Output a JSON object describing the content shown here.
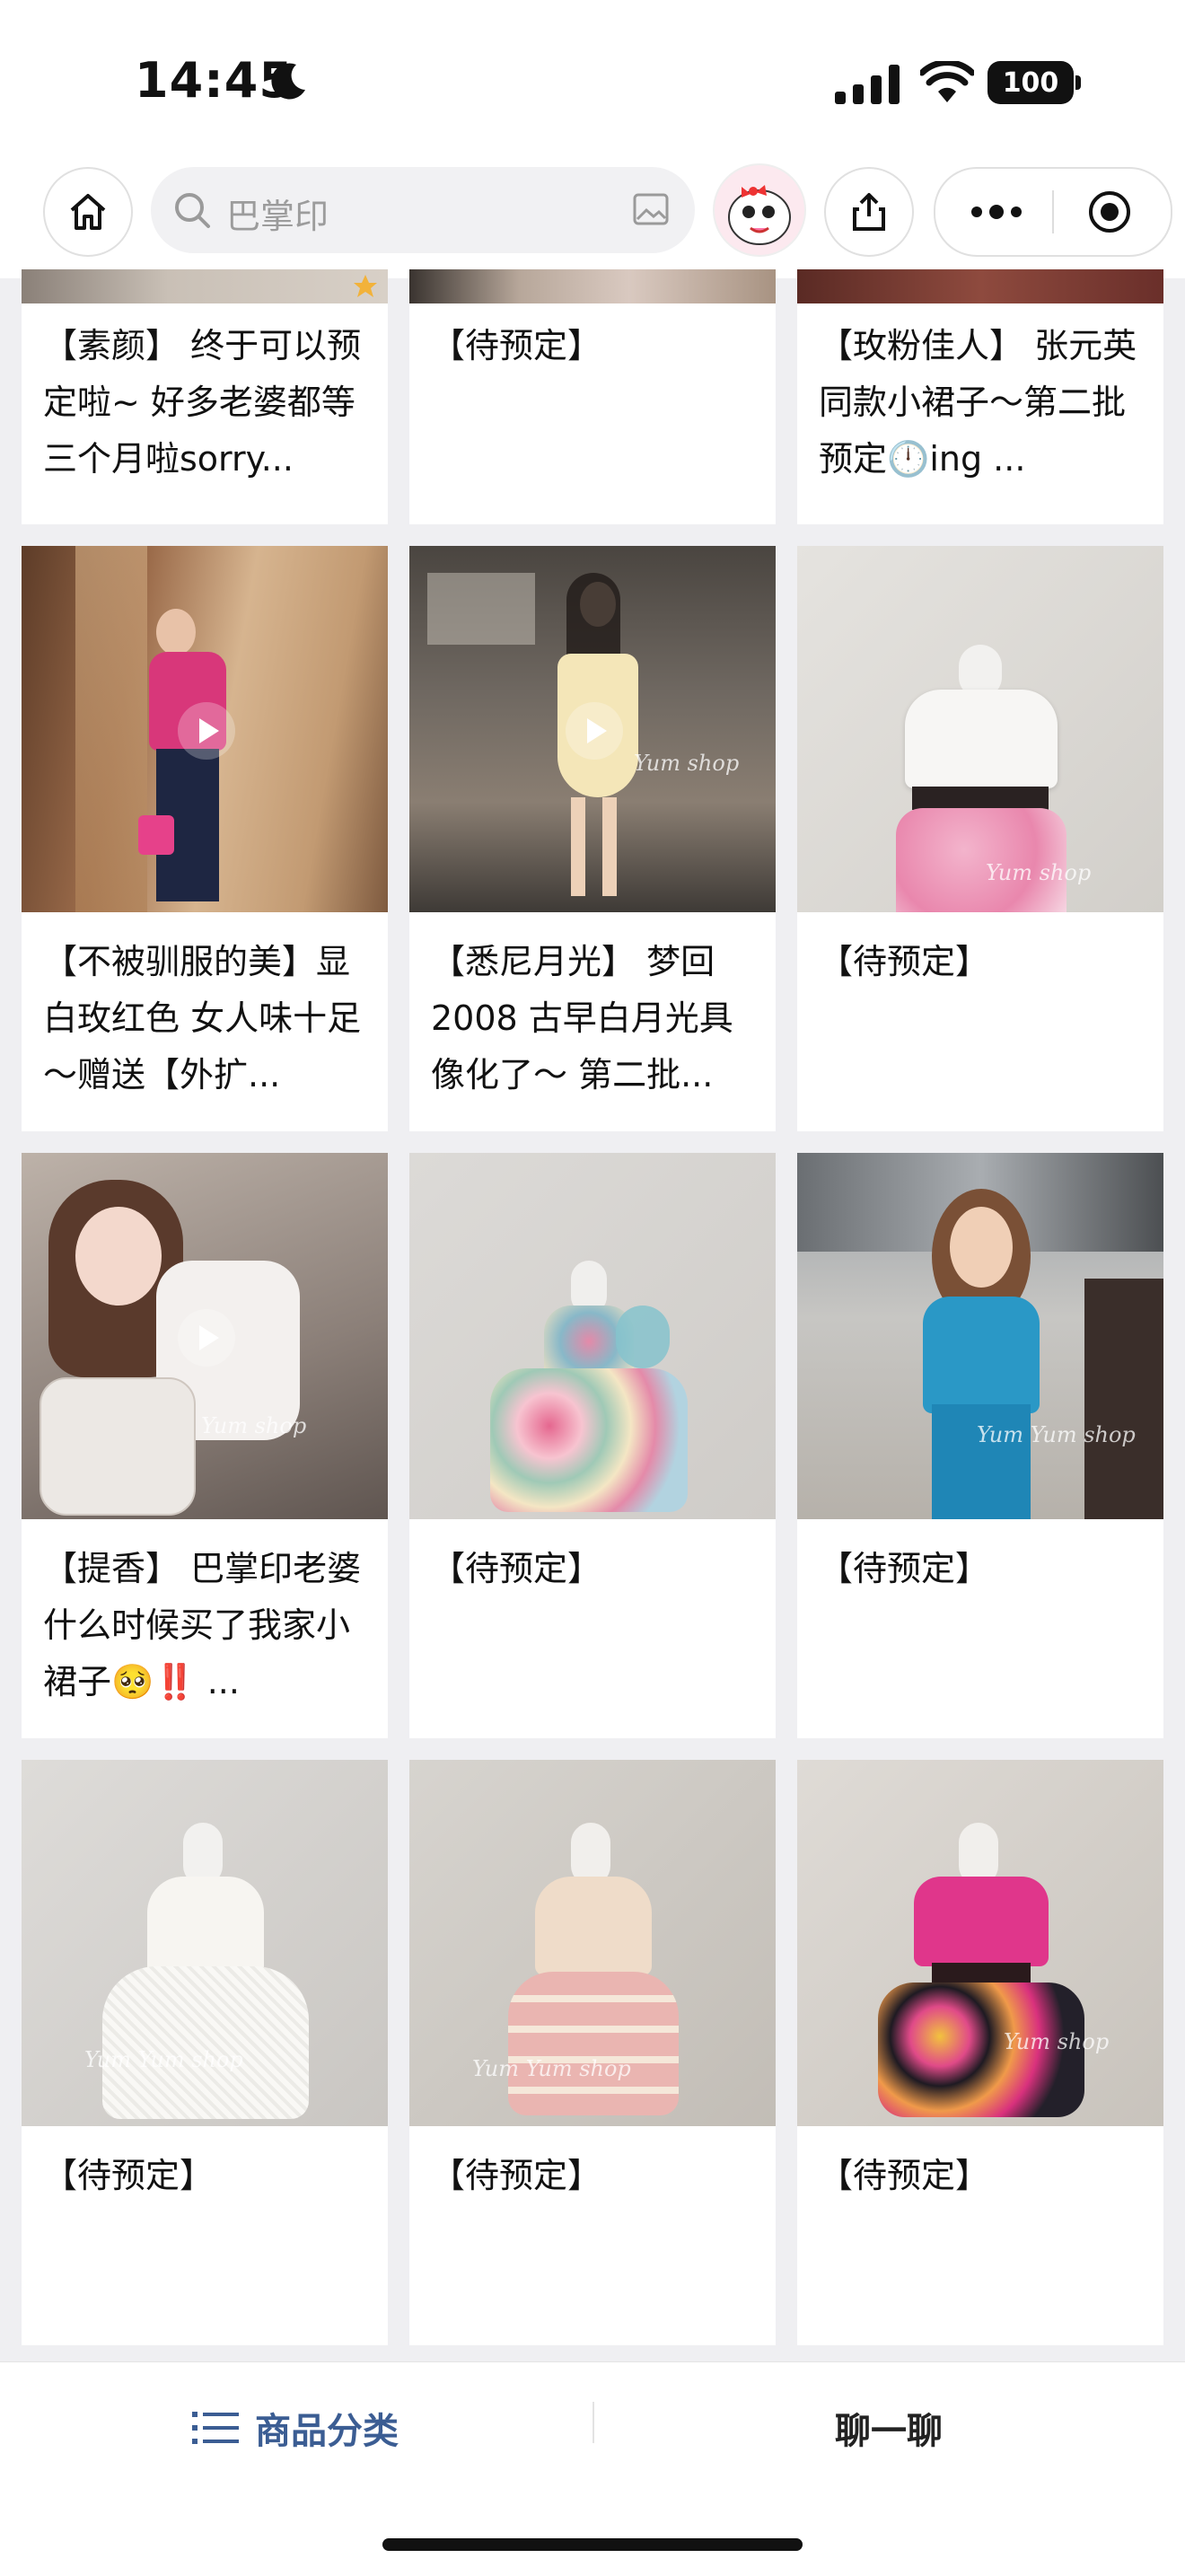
{
  "status_bar": {
    "time": "14:45",
    "battery": "100"
  },
  "top_bar": {
    "search_placeholder": "巴掌印"
  },
  "products": [
    {
      "title": "【素颜】 终于可以预定啦~ 好多老婆都等三个月啦sorry..."
    },
    {
      "title": "【待预定】"
    },
    {
      "title": "【玫粉佳人】 张元英同款小裙子～第二批预定🕛ing ..."
    },
    {
      "title": "【不被驯服的美】显白玫红色 女人味十足～赠送【外扩..."
    },
    {
      "title": "【悉尼月光】 梦回2008 古早白月光具像化了～ 第二批..."
    },
    {
      "title": "【待预定】"
    },
    {
      "title": "【提香】 巴掌印老婆什么时候买了我家小裙子🥺‼️ ..."
    },
    {
      "title": "【待预定】"
    },
    {
      "title": "【待预定】"
    },
    {
      "title": "【待预定】"
    },
    {
      "title": "【待预定】"
    },
    {
      "title": "【待预定】"
    }
  ],
  "bottom_bar": {
    "category_label": "商品分类",
    "chat_label": "聊一聊"
  },
  "colors": {
    "accent": "#3b5d93",
    "background": "#efeff2"
  }
}
